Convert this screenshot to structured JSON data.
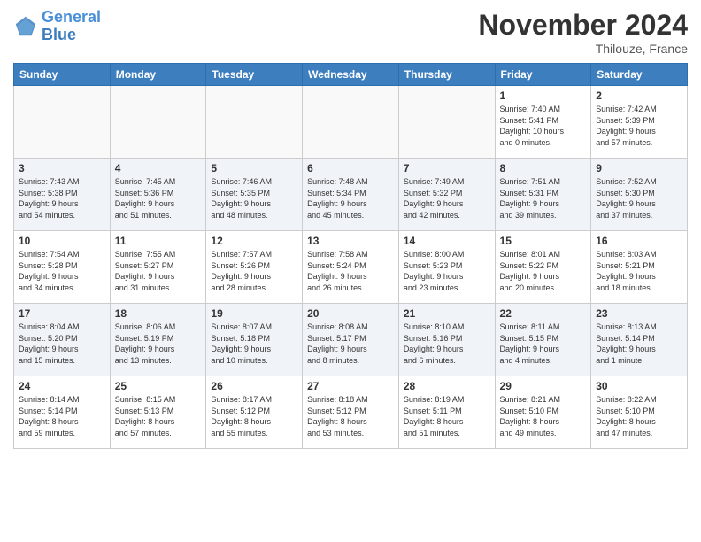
{
  "logo": {
    "line1": "General",
    "line2": "Blue"
  },
  "title": "November 2024",
  "location": "Thilouze, France",
  "weekdays": [
    "Sunday",
    "Monday",
    "Tuesday",
    "Wednesday",
    "Thursday",
    "Friday",
    "Saturday"
  ],
  "weeks": [
    [
      {
        "day": "",
        "info": ""
      },
      {
        "day": "",
        "info": ""
      },
      {
        "day": "",
        "info": ""
      },
      {
        "day": "",
        "info": ""
      },
      {
        "day": "",
        "info": ""
      },
      {
        "day": "1",
        "info": "Sunrise: 7:40 AM\nSunset: 5:41 PM\nDaylight: 10 hours\nand 0 minutes."
      },
      {
        "day": "2",
        "info": "Sunrise: 7:42 AM\nSunset: 5:39 PM\nDaylight: 9 hours\nand 57 minutes."
      }
    ],
    [
      {
        "day": "3",
        "info": "Sunrise: 7:43 AM\nSunset: 5:38 PM\nDaylight: 9 hours\nand 54 minutes."
      },
      {
        "day": "4",
        "info": "Sunrise: 7:45 AM\nSunset: 5:36 PM\nDaylight: 9 hours\nand 51 minutes."
      },
      {
        "day": "5",
        "info": "Sunrise: 7:46 AM\nSunset: 5:35 PM\nDaylight: 9 hours\nand 48 minutes."
      },
      {
        "day": "6",
        "info": "Sunrise: 7:48 AM\nSunset: 5:34 PM\nDaylight: 9 hours\nand 45 minutes."
      },
      {
        "day": "7",
        "info": "Sunrise: 7:49 AM\nSunset: 5:32 PM\nDaylight: 9 hours\nand 42 minutes."
      },
      {
        "day": "8",
        "info": "Sunrise: 7:51 AM\nSunset: 5:31 PM\nDaylight: 9 hours\nand 39 minutes."
      },
      {
        "day": "9",
        "info": "Sunrise: 7:52 AM\nSunset: 5:30 PM\nDaylight: 9 hours\nand 37 minutes."
      }
    ],
    [
      {
        "day": "10",
        "info": "Sunrise: 7:54 AM\nSunset: 5:28 PM\nDaylight: 9 hours\nand 34 minutes."
      },
      {
        "day": "11",
        "info": "Sunrise: 7:55 AM\nSunset: 5:27 PM\nDaylight: 9 hours\nand 31 minutes."
      },
      {
        "day": "12",
        "info": "Sunrise: 7:57 AM\nSunset: 5:26 PM\nDaylight: 9 hours\nand 28 minutes."
      },
      {
        "day": "13",
        "info": "Sunrise: 7:58 AM\nSunset: 5:24 PM\nDaylight: 9 hours\nand 26 minutes."
      },
      {
        "day": "14",
        "info": "Sunrise: 8:00 AM\nSunset: 5:23 PM\nDaylight: 9 hours\nand 23 minutes."
      },
      {
        "day": "15",
        "info": "Sunrise: 8:01 AM\nSunset: 5:22 PM\nDaylight: 9 hours\nand 20 minutes."
      },
      {
        "day": "16",
        "info": "Sunrise: 8:03 AM\nSunset: 5:21 PM\nDaylight: 9 hours\nand 18 minutes."
      }
    ],
    [
      {
        "day": "17",
        "info": "Sunrise: 8:04 AM\nSunset: 5:20 PM\nDaylight: 9 hours\nand 15 minutes."
      },
      {
        "day": "18",
        "info": "Sunrise: 8:06 AM\nSunset: 5:19 PM\nDaylight: 9 hours\nand 13 minutes."
      },
      {
        "day": "19",
        "info": "Sunrise: 8:07 AM\nSunset: 5:18 PM\nDaylight: 9 hours\nand 10 minutes."
      },
      {
        "day": "20",
        "info": "Sunrise: 8:08 AM\nSunset: 5:17 PM\nDaylight: 9 hours\nand 8 minutes."
      },
      {
        "day": "21",
        "info": "Sunrise: 8:10 AM\nSunset: 5:16 PM\nDaylight: 9 hours\nand 6 minutes."
      },
      {
        "day": "22",
        "info": "Sunrise: 8:11 AM\nSunset: 5:15 PM\nDaylight: 9 hours\nand 4 minutes."
      },
      {
        "day": "23",
        "info": "Sunrise: 8:13 AM\nSunset: 5:14 PM\nDaylight: 9 hours\nand 1 minute."
      }
    ],
    [
      {
        "day": "24",
        "info": "Sunrise: 8:14 AM\nSunset: 5:14 PM\nDaylight: 8 hours\nand 59 minutes."
      },
      {
        "day": "25",
        "info": "Sunrise: 8:15 AM\nSunset: 5:13 PM\nDaylight: 8 hours\nand 57 minutes."
      },
      {
        "day": "26",
        "info": "Sunrise: 8:17 AM\nSunset: 5:12 PM\nDaylight: 8 hours\nand 55 minutes."
      },
      {
        "day": "27",
        "info": "Sunrise: 8:18 AM\nSunset: 5:12 PM\nDaylight: 8 hours\nand 53 minutes."
      },
      {
        "day": "28",
        "info": "Sunrise: 8:19 AM\nSunset: 5:11 PM\nDaylight: 8 hours\nand 51 minutes."
      },
      {
        "day": "29",
        "info": "Sunrise: 8:21 AM\nSunset: 5:10 PM\nDaylight: 8 hours\nand 49 minutes."
      },
      {
        "day": "30",
        "info": "Sunrise: 8:22 AM\nSunset: 5:10 PM\nDaylight: 8 hours\nand 47 minutes."
      }
    ]
  ]
}
